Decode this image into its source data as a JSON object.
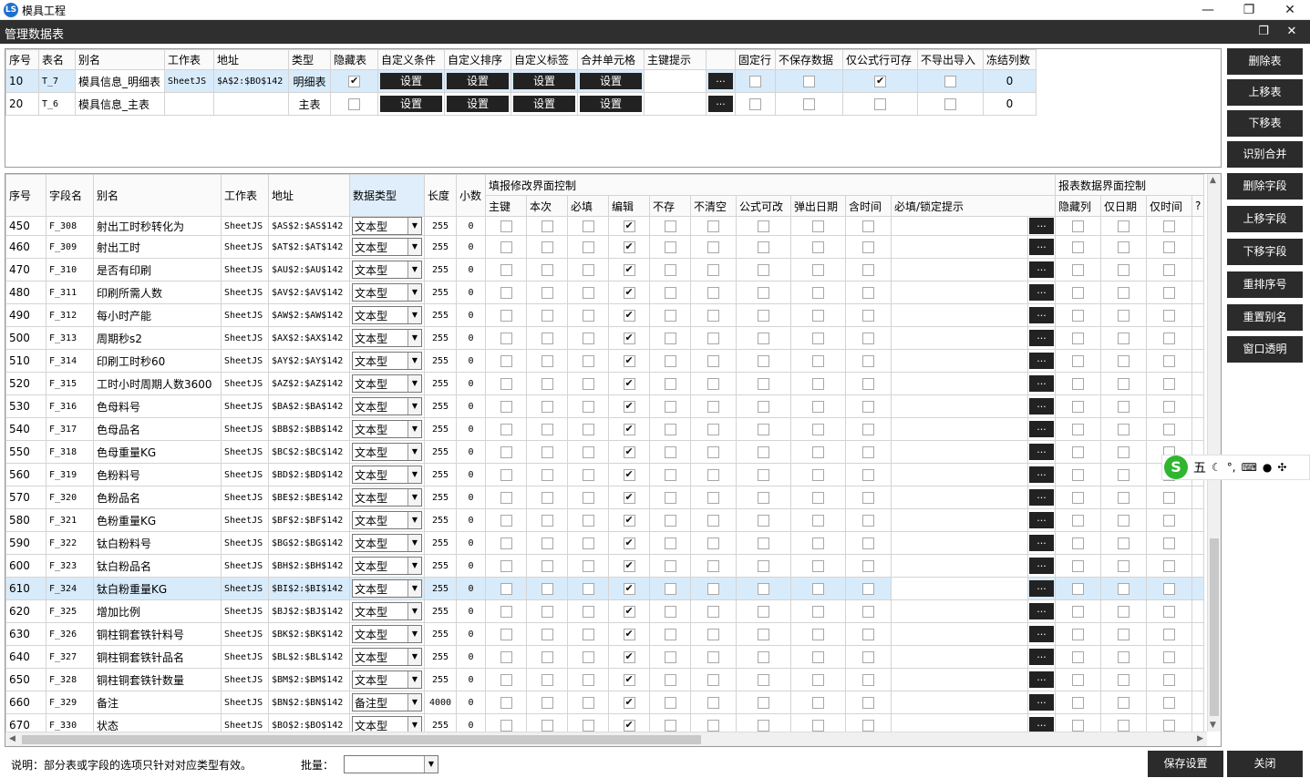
{
  "window": {
    "title": "模具工程",
    "logo": "LS"
  },
  "dialog": {
    "title": "管理数据表"
  },
  "top_table": {
    "headers": [
      "序号",
      "表名",
      "别名",
      "工作表",
      "地址",
      "类型",
      "隐藏表",
      "自定义条件",
      "自定义排序",
      "自定义标签",
      "合并单元格",
      "主键提示",
      "",
      "固定行",
      "不保存数据",
      "仅公式行可存",
      "不导出导入",
      "冻结列数"
    ],
    "set_label": "设置",
    "ellipsis": "...",
    "rows": [
      {
        "seq": "10",
        "name": "T_7",
        "alias": "模具信息_明细表",
        "sheet": "SheetJS",
        "addr": "$A$2:$BO$142",
        "type": "明细表",
        "hidden": true,
        "fixed": false,
        "nosave": false,
        "formula": true,
        "noexport": false,
        "freeze": "0"
      },
      {
        "seq": "20",
        "name": "T_6",
        "alias": "模具信息_主表",
        "sheet": "",
        "addr": "",
        "type": "主表",
        "hidden": false,
        "fixed": false,
        "nosave": false,
        "formula": false,
        "noexport": false,
        "freeze": "0"
      }
    ]
  },
  "field_table": {
    "headers": {
      "seq": "序号",
      "field": "字段名",
      "alias": "别名",
      "sheet": "工作表",
      "addr": "地址",
      "dtype": "数据类型",
      "len": "长度",
      "dec": "小数"
    },
    "group1": "填报修改界面控制",
    "group1_cols": [
      "主键",
      "本次",
      "必填",
      "编辑",
      "不存",
      "不清空",
      "公式可改",
      "弹出日期",
      "含时间",
      "必填/锁定提示"
    ],
    "group2": "报表数据界面控制",
    "group2_cols": [
      "隐藏列",
      "仅日期",
      "仅时间",
      "?"
    ],
    "ellipsis": "...",
    "partial_row": {
      "seq": "450",
      "field": "F_308",
      "alias": "射出工时秒转化为",
      "sheet": "SheetJS",
      "addr": "$AS$2:$AS$142",
      "dtype": "文本型",
      "len": "255",
      "dec": "0"
    },
    "rows": [
      {
        "seq": "460",
        "field": "F_309",
        "alias": "射出工时",
        "addr": "$AT$2:$AT$142",
        "dtype": "文本型",
        "len": "255",
        "dec": "0"
      },
      {
        "seq": "470",
        "field": "F_310",
        "alias": "是否有印刷",
        "addr": "$AU$2:$AU$142",
        "dtype": "文本型",
        "len": "255",
        "dec": "0"
      },
      {
        "seq": "480",
        "field": "F_311",
        "alias": "印刷所需人数",
        "addr": "$AV$2:$AV$142",
        "dtype": "文本型",
        "len": "255",
        "dec": "0"
      },
      {
        "seq": "490",
        "field": "F_312",
        "alias": "每小时产能",
        "addr": "$AW$2:$AW$142",
        "dtype": "文本型",
        "len": "255",
        "dec": "0"
      },
      {
        "seq": "500",
        "field": "F_313",
        "alias": "周期秒s2",
        "addr": "$AX$2:$AX$142",
        "dtype": "文本型",
        "len": "255",
        "dec": "0"
      },
      {
        "seq": "510",
        "field": "F_314",
        "alias": "印刷工时秒60",
        "addr": "$AY$2:$AY$142",
        "dtype": "文本型",
        "len": "255",
        "dec": "0"
      },
      {
        "seq": "520",
        "field": "F_315",
        "alias": "工时小时周期人数3600",
        "addr": "$AZ$2:$AZ$142",
        "dtype": "文本型",
        "len": "255",
        "dec": "0"
      },
      {
        "seq": "530",
        "field": "F_316",
        "alias": "色母料号",
        "addr": "$BA$2:$BA$142",
        "dtype": "文本型",
        "len": "255",
        "dec": "0"
      },
      {
        "seq": "540",
        "field": "F_317",
        "alias": "色母品名",
        "addr": "$BB$2:$BB$142",
        "dtype": "文本型",
        "len": "255",
        "dec": "0"
      },
      {
        "seq": "550",
        "field": "F_318",
        "alias": "色母重量KG",
        "addr": "$BC$2:$BC$142",
        "dtype": "文本型",
        "len": "255",
        "dec": "0"
      },
      {
        "seq": "560",
        "field": "F_319",
        "alias": "色粉料号",
        "addr": "$BD$2:$BD$142",
        "dtype": "文本型",
        "len": "255",
        "dec": "0"
      },
      {
        "seq": "570",
        "field": "F_320",
        "alias": "色粉品名",
        "addr": "$BE$2:$BE$142",
        "dtype": "文本型",
        "len": "255",
        "dec": "0"
      },
      {
        "seq": "580",
        "field": "F_321",
        "alias": "色粉重量KG",
        "addr": "$BF$2:$BF$142",
        "dtype": "文本型",
        "len": "255",
        "dec": "0"
      },
      {
        "seq": "590",
        "field": "F_322",
        "alias": "钛白粉料号",
        "addr": "$BG$2:$BG$142",
        "dtype": "文本型",
        "len": "255",
        "dec": "0"
      },
      {
        "seq": "600",
        "field": "F_323",
        "alias": "钛白粉品名",
        "addr": "$BH$2:$BH$142",
        "dtype": "文本型",
        "len": "255",
        "dec": "0"
      },
      {
        "seq": "610",
        "field": "F_324",
        "alias": "钛白粉重量KG",
        "addr": "$BI$2:$BI$142",
        "dtype": "文本型",
        "len": "255",
        "dec": "0",
        "selected": true
      },
      {
        "seq": "620",
        "field": "F_325",
        "alias": "增加比例",
        "addr": "$BJ$2:$BJ$142",
        "dtype": "文本型",
        "len": "255",
        "dec": "0"
      },
      {
        "seq": "630",
        "field": "F_326",
        "alias": "铜柱铜套铁针料号",
        "addr": "$BK$2:$BK$142",
        "dtype": "文本型",
        "len": "255",
        "dec": "0"
      },
      {
        "seq": "640",
        "field": "F_327",
        "alias": "铜柱铜套铁针品名",
        "addr": "$BL$2:$BL$142",
        "dtype": "文本型",
        "len": "255",
        "dec": "0"
      },
      {
        "seq": "650",
        "field": "F_328",
        "alias": "铜柱铜套铁针数量",
        "addr": "$BM$2:$BM$142",
        "dtype": "文本型",
        "len": "255",
        "dec": "0"
      },
      {
        "seq": "660",
        "field": "F_329",
        "alias": "备注",
        "addr": "$BN$2:$BN$142",
        "dtype": "备注型",
        "len": "4000",
        "dec": "0"
      },
      {
        "seq": "670",
        "field": "F_330",
        "alias": "状态",
        "addr": "$BO$2:$BO$142",
        "dtype": "文本型",
        "len": "255",
        "dec": "0"
      }
    ],
    "sheet_value": "SheetJS"
  },
  "side_buttons": [
    "删除表",
    "上移表",
    "下移表",
    "识别合并",
    "删除字段",
    "上移字段",
    "下移字段",
    "重排序号",
    "重置别名",
    "窗口透明"
  ],
  "ime": {
    "label": "五",
    "icons": [
      "moon-icon",
      "punct-icon",
      "keyboard-icon",
      "user-icon",
      "apps-icon"
    ]
  },
  "bottom": {
    "note": "说明：部分表或字段的选项只针对对应类型有效。",
    "batch_label": "批量：",
    "batch_value": "",
    "save": "保存设置",
    "close": "关闭"
  }
}
